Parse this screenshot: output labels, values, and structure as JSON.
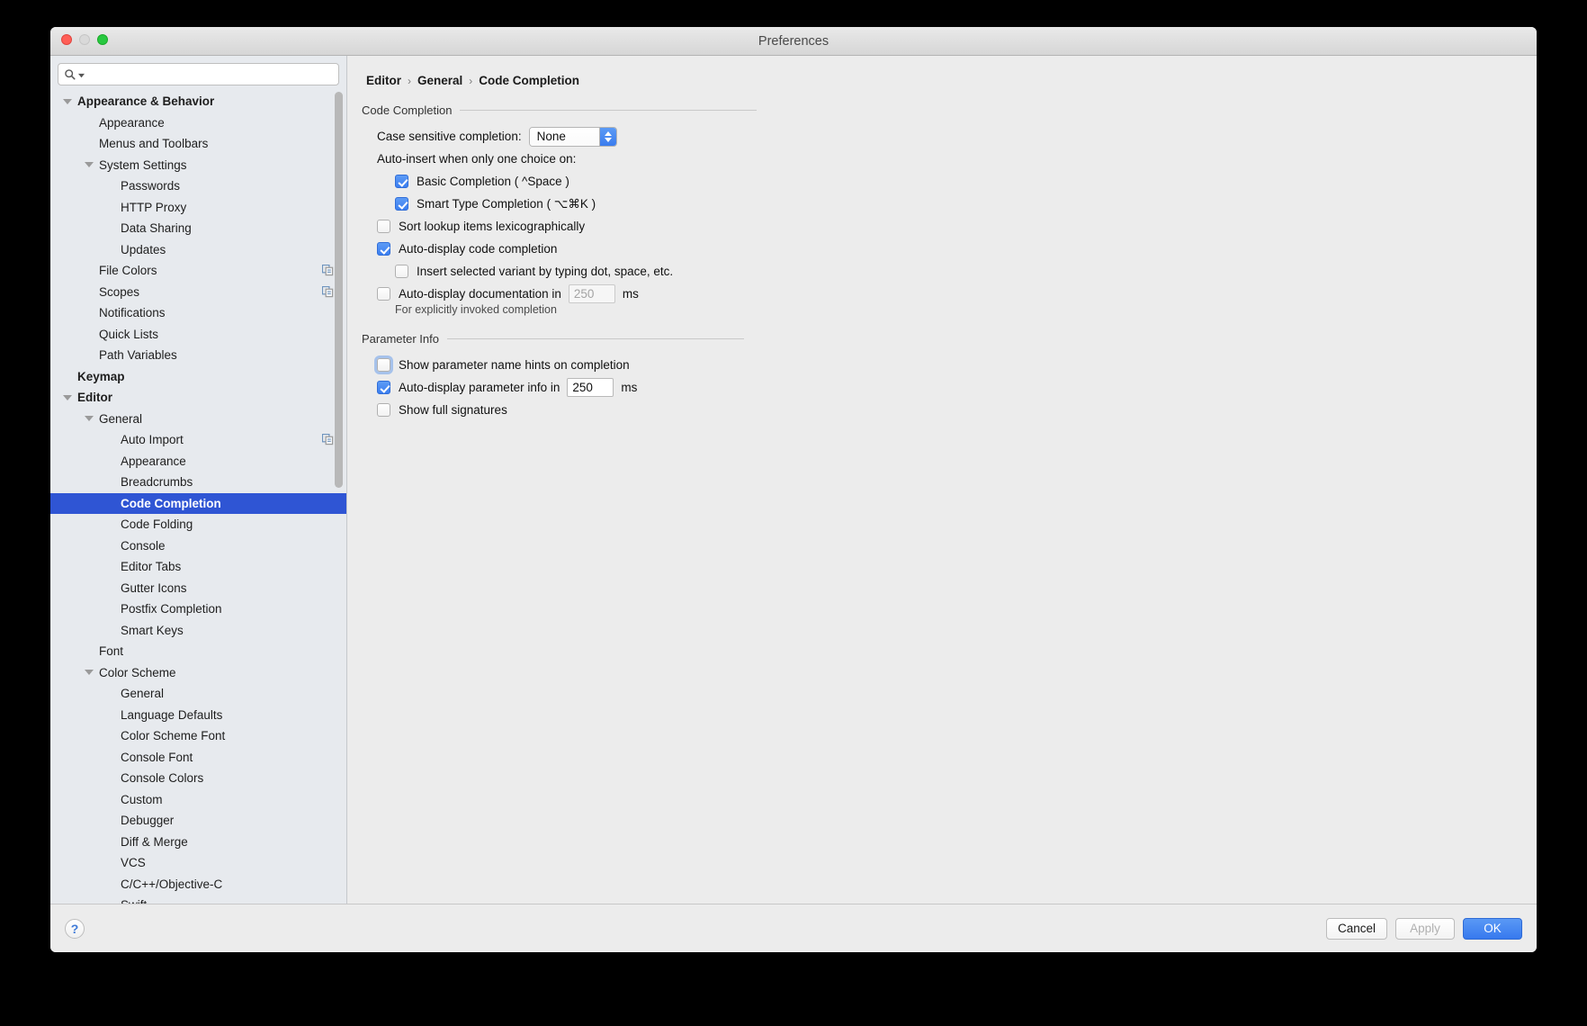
{
  "window": {
    "title": "Preferences",
    "traffic_lights": [
      "close",
      "minimize",
      "zoom"
    ]
  },
  "sidebar": {
    "search": {
      "placeholder": "",
      "value": "",
      "icon": "search-icon"
    },
    "items": [
      {
        "label": "Appearance & Behavior",
        "depth": 0,
        "bold": true,
        "twisty": "expanded"
      },
      {
        "label": "Appearance",
        "depth": 1
      },
      {
        "label": "Menus and Toolbars",
        "depth": 1
      },
      {
        "label": "System Settings",
        "depth": 1,
        "twisty": "expanded"
      },
      {
        "label": "Passwords",
        "depth": 2
      },
      {
        "label": "HTTP Proxy",
        "depth": 2
      },
      {
        "label": "Data Sharing",
        "depth": 2
      },
      {
        "label": "Updates",
        "depth": 2
      },
      {
        "label": "File Colors",
        "depth": 1,
        "copy_icon": true
      },
      {
        "label": "Scopes",
        "depth": 1,
        "copy_icon": true
      },
      {
        "label": "Notifications",
        "depth": 1
      },
      {
        "label": "Quick Lists",
        "depth": 1
      },
      {
        "label": "Path Variables",
        "depth": 1
      },
      {
        "label": "Keymap",
        "depth": 0,
        "bold": true
      },
      {
        "label": "Editor",
        "depth": 0,
        "bold": true,
        "twisty": "expanded"
      },
      {
        "label": "General",
        "depth": 1,
        "twisty": "expanded"
      },
      {
        "label": "Auto Import",
        "depth": 2,
        "copy_icon": true
      },
      {
        "label": "Appearance",
        "depth": 2
      },
      {
        "label": "Breadcrumbs",
        "depth": 2
      },
      {
        "label": "Code Completion",
        "depth": 2,
        "selected": true
      },
      {
        "label": "Code Folding",
        "depth": 2
      },
      {
        "label": "Console",
        "depth": 2
      },
      {
        "label": "Editor Tabs",
        "depth": 2
      },
      {
        "label": "Gutter Icons",
        "depth": 2
      },
      {
        "label": "Postfix Completion",
        "depth": 2
      },
      {
        "label": "Smart Keys",
        "depth": 2
      },
      {
        "label": "Font",
        "depth": 1
      },
      {
        "label": "Color Scheme",
        "depth": 1,
        "twisty": "expanded"
      },
      {
        "label": "General",
        "depth": 2
      },
      {
        "label": "Language Defaults",
        "depth": 2
      },
      {
        "label": "Color Scheme Font",
        "depth": 2
      },
      {
        "label": "Console Font",
        "depth": 2
      },
      {
        "label": "Console Colors",
        "depth": 2
      },
      {
        "label": "Custom",
        "depth": 2
      },
      {
        "label": "Debugger",
        "depth": 2
      },
      {
        "label": "Diff & Merge",
        "depth": 2
      },
      {
        "label": "VCS",
        "depth": 2
      },
      {
        "label": "C/C++/Objective-C",
        "depth": 2
      },
      {
        "label": "Swift",
        "depth": 2
      }
    ]
  },
  "main": {
    "breadcrumb": [
      "Editor",
      "General",
      "Code Completion"
    ],
    "breadcrumb_separator": "›",
    "groups": [
      {
        "title": "Code Completion",
        "rows": [
          {
            "kind": "select",
            "label": "Case sensitive completion:",
            "value": "None"
          },
          {
            "kind": "text",
            "label": "Auto-insert when only one choice on:"
          },
          {
            "kind": "checkbox",
            "label": "Basic Completion ( ^Space )",
            "checked": true,
            "indent": 2
          },
          {
            "kind": "checkbox",
            "label": "Smart Type Completion ( ⌥⌘K )",
            "checked": true,
            "indent": 2
          },
          {
            "kind": "checkbox",
            "label": "Sort lookup items lexicographically",
            "checked": false,
            "indent": 1
          },
          {
            "kind": "checkbox",
            "label": "Auto-display code completion",
            "checked": true,
            "indent": 1
          },
          {
            "kind": "checkbox",
            "label": "Insert selected variant by typing dot, space, etc.",
            "checked": false,
            "indent": 2
          },
          {
            "kind": "checkbox-field",
            "label": "Auto-display documentation in",
            "checked": false,
            "field_value": "250",
            "field_disabled": true,
            "unit": "ms",
            "indent": 1,
            "hint": "For explicitly invoked completion"
          }
        ]
      },
      {
        "title": "Parameter Info",
        "rows": [
          {
            "kind": "checkbox",
            "label": "Show parameter name hints on completion",
            "checked": false,
            "focused": true,
            "indent": 1
          },
          {
            "kind": "checkbox-field",
            "label": "Auto-display parameter info in",
            "checked": true,
            "field_value": "250",
            "field_disabled": false,
            "unit": "ms",
            "indent": 1
          },
          {
            "kind": "checkbox",
            "label": "Show full signatures",
            "checked": false,
            "indent": 1
          }
        ]
      }
    ]
  },
  "footer": {
    "help_label": "?",
    "cancel_label": "Cancel",
    "apply_label": "Apply",
    "ok_label": "OK",
    "apply_disabled": true
  },
  "colors": {
    "accent": "#3779ee",
    "selection": "#2f55d4",
    "sidebar_bg": "#e7eaee",
    "panel_bg": "#ececec"
  }
}
